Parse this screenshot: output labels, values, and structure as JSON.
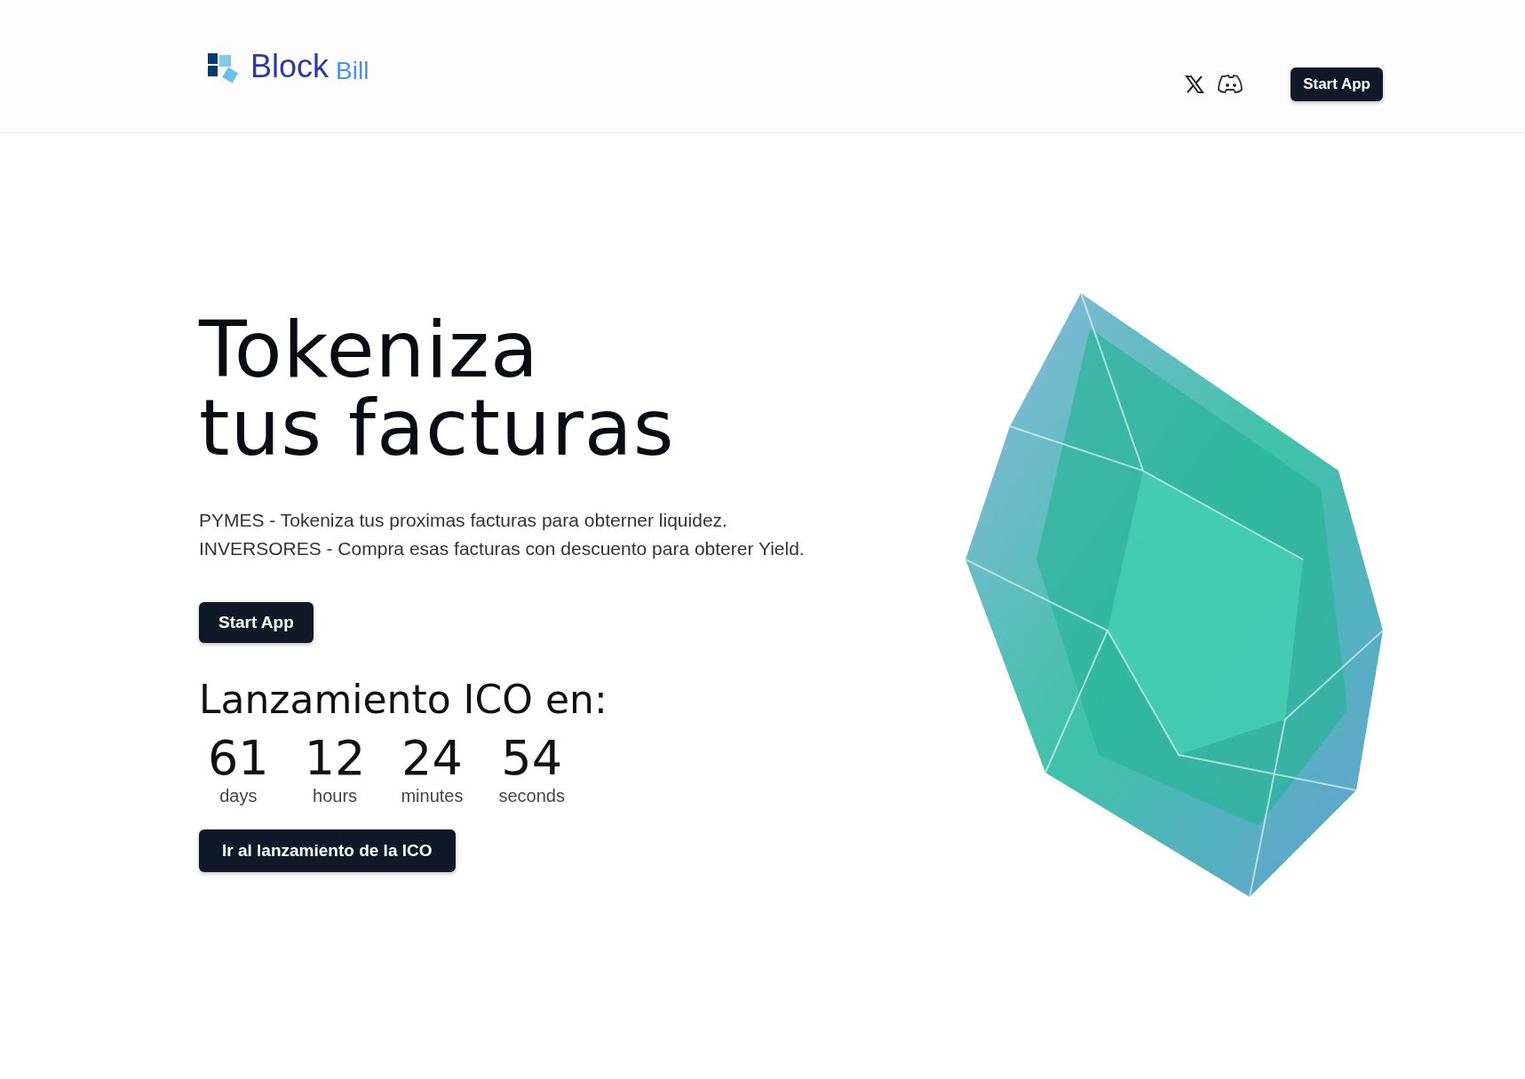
{
  "header": {
    "logo": {
      "primary": "Block",
      "secondary": "Bill"
    },
    "button": "Start App"
  },
  "hero": {
    "title_lines": [
      "Tokeniza",
      "tus facturas"
    ],
    "description": [
      "PYMES - Tokeniza tus proximas facturas para obterner liquidez.",
      "INVERSORES - Compra esas facturas con descuento para obterer Yield."
    ],
    "button": "Start App"
  },
  "countdown": {
    "title": "Lanzamiento ICO en:",
    "units": [
      {
        "value": "61",
        "label": "days"
      },
      {
        "value": "12",
        "label": "hours"
      },
      {
        "value": "24",
        "label": "minutes"
      },
      {
        "value": "54",
        "label": "seconds"
      }
    ],
    "button": "Ir al lanzamiento de la ICO"
  }
}
